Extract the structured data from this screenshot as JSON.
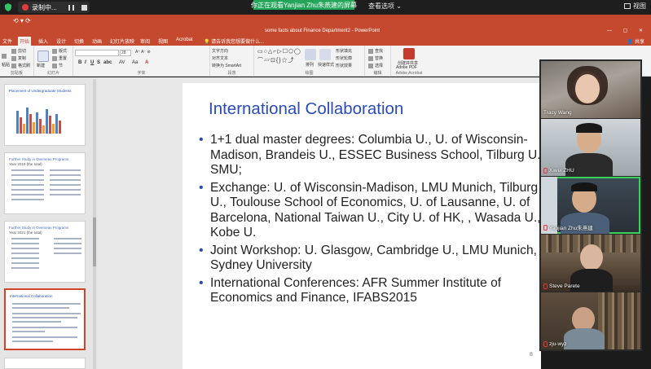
{
  "meeting": {
    "recording_label": "录制中...",
    "viewing_banner": "你正在观看Yanjian Zhu朱燕建的屏幕",
    "view_options": "查看选项",
    "view_button": "视图"
  },
  "ppt": {
    "window_title": "some facts about Finance Department2 - PowerPoint",
    "share": "共享",
    "tabs": [
      "文件",
      "开始",
      "插入",
      "设计",
      "切换",
      "动画",
      "幻灯片放映",
      "审阅",
      "视图",
      "Acrobat",
      "请告诉我您想要做什么..."
    ],
    "active_tab": "开始",
    "ribbon": {
      "clipboard": {
        "paste": "粘贴",
        "cut": "剪切",
        "copy": "复制",
        "format": "格式刷",
        "label": "剪贴板"
      },
      "slides": {
        "new": "新建",
        "new2": "幻灯片",
        "layout": "版式",
        "reset": "重置",
        "section": "节",
        "label": "幻灯片"
      },
      "font": {
        "label": "字体",
        "size": "28"
      },
      "paragraph": {
        "dir": "文字方向",
        "align": "对齐文本",
        "smartart": "转换为 SmartArt",
        "label": "段落"
      },
      "drawing": {
        "arrange": "排列",
        "quick": "快速样式",
        "fill": "形状填充",
        "outline": "形状轮廓",
        "effect": "形状效果",
        "label": "绘图"
      },
      "editing": {
        "find": "查找",
        "replace": "替换",
        "select": "选择",
        "label": "编辑"
      },
      "acrobat": {
        "create": "创建并共享",
        "pdf": "Adobe PDF",
        "label": "Adobe Acrobat"
      }
    },
    "thumbnails": [
      {
        "title": "Placement of Undergraduate Students"
      },
      {
        "title": "Further Study in Overseas Programs",
        "sub": "Year 2019 (the total)"
      },
      {
        "title": "Further Study in Overseas Programs",
        "sub": "Year 2021 (the total)"
      },
      {
        "title": "International Collaboration"
      }
    ],
    "slide": {
      "title": "International Collaboration",
      "bullets": [
        "1+1 dual master degrees: Columbia U., U. of Wisconsin-Madison, Brandeis U., ESSEC Business School, Tilburg U., SMU;",
        "Exchange: U. of Wisconsin-Madison, LMU Munich, Tilburg U., Toulouse School of Economics, U. of Lausanne, U. of Barcelona, National Taiwan U., City U. of HK, , Wasada U., Kobe U.",
        "Joint Workshop: U. Glasgow, Cambridge U., LMU Munich, Sydney University",
        "International Conferences: AFR Summer Institute of Economics and Finance, IFABS2015"
      ],
      "page_number": "8"
    }
  },
  "participants": [
    {
      "name": "Tracy Wang",
      "muted": false
    },
    {
      "name": "Xiwei ZHU",
      "muted": true
    },
    {
      "name": "Yanjian Zhu朱燕建",
      "muted": true
    },
    {
      "name": "Steve Parete",
      "muted": true
    },
    {
      "name": "zju-wyz",
      "muted": true
    }
  ]
}
